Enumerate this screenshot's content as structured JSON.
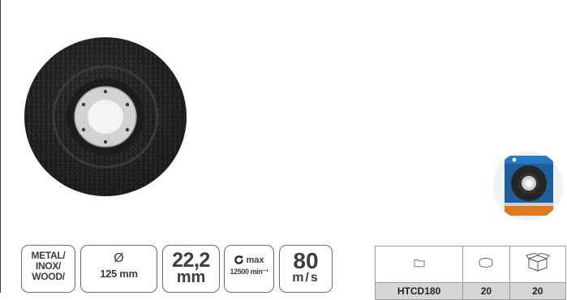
{
  "badges": {
    "material": [
      "METAL/",
      "INOX/",
      "WOOD/"
    ],
    "diameter_symbol": "Ø",
    "diameter": "125 mm",
    "bore_number": "22,2",
    "bore_unit": "mm",
    "max_label": "max",
    "max_rpm": "12500 min⁻¹",
    "speed_number": "80",
    "speed_unit": "m/s"
  },
  "table": {
    "header_icons": [
      "folder-icon",
      "single-unit-icon",
      "box-icon"
    ],
    "rows": [
      {
        "code": "HTCD180",
        "qty_unit": "20",
        "qty_box": "20"
      }
    ]
  },
  "colors": {
    "disc": "#2b2b2b",
    "hub": "#cfcfcf",
    "badge_border": "#6b6b6b",
    "table_row": "#d6d6d6",
    "pack_blue": "#1f5f9e",
    "pack_orange": "#e07a1f"
  }
}
